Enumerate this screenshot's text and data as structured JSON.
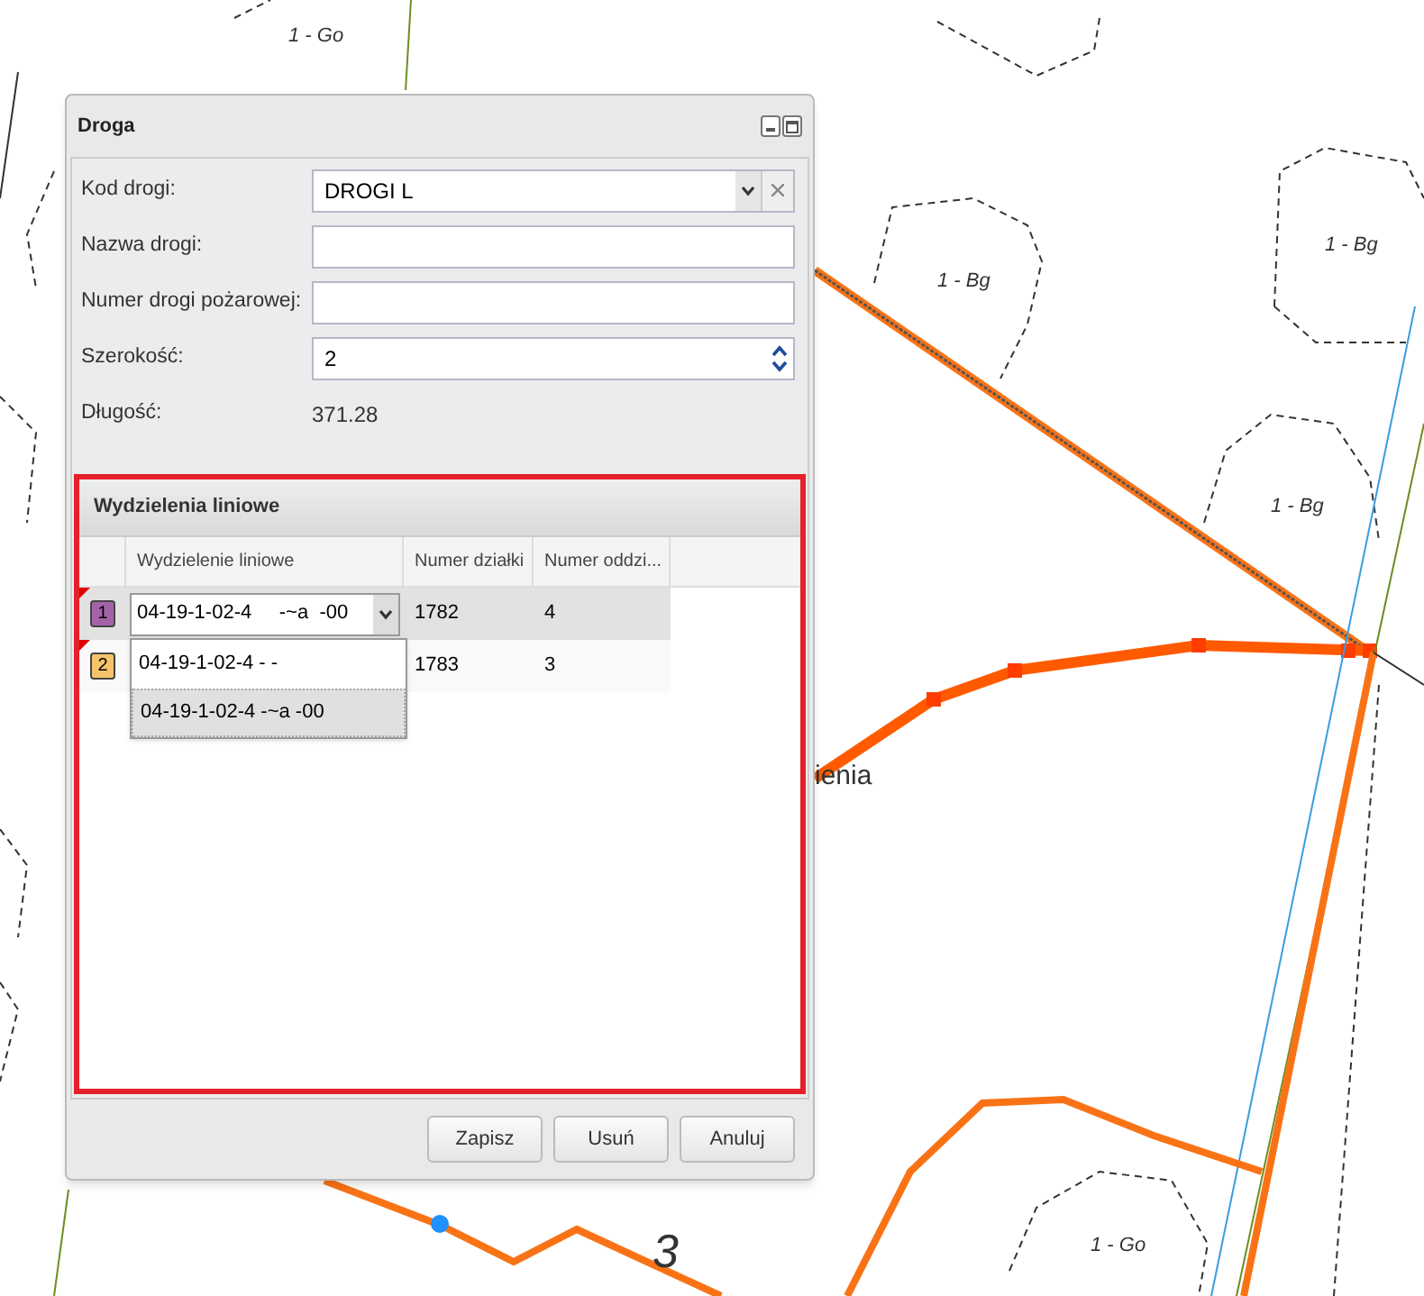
{
  "map": {
    "labels": [
      "1 - Go",
      "1 - Bg",
      "1 - Bg",
      "1 - Bg",
      "ienia",
      "3",
      "1 - Go"
    ]
  },
  "window": {
    "title": "Droga"
  },
  "form": {
    "fields": [
      {
        "kind": "combo",
        "label": "Kod drogi:",
        "value": "DROGI L"
      },
      {
        "kind": "text",
        "label": "Nazwa drogi:"
      },
      {
        "kind": "text",
        "label": "Numer drogi pożarowej:"
      },
      {
        "kind": "spinner",
        "label": "Szerokość:",
        "value": "2"
      },
      {
        "kind": "display",
        "label": "Długość:",
        "value": "371.28"
      }
    ]
  },
  "grid": {
    "title": "Wydzielenia liniowe",
    "highlighted": true,
    "columns": [
      "Wydzielenie liniowe",
      "Numer działki",
      "Numer oddzi..."
    ],
    "rows": [
      {
        "number": "1",
        "color": "#a463a8",
        "selected": true,
        "cells": [
          "04-19-1-02-4     -~a  -00",
          "1782",
          "4"
        ]
      },
      {
        "number": "2",
        "color": "#f5c36a",
        "selected": false,
        "cells": [
          "",
          "1783",
          "3"
        ]
      }
    ],
    "dropdown": [
      {
        "text": "04-19-1-02-4 - -",
        "selected": false
      },
      {
        "text": "04-19-1-02-4 -~a -00",
        "selected": true
      }
    ]
  },
  "buttons": [
    "Zapisz",
    "Usuń",
    "Anuluj"
  ]
}
